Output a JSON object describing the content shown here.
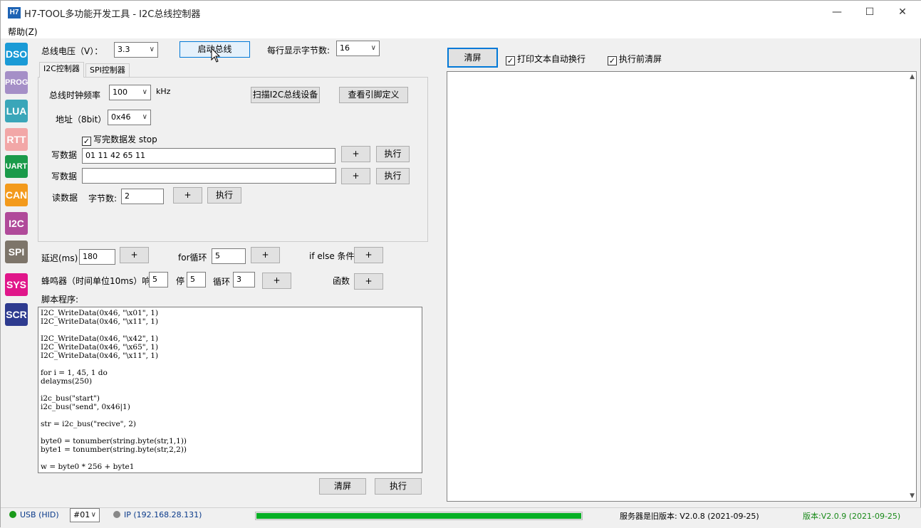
{
  "window": {
    "icon_text": "H7",
    "title": "H7-TOOL多功能开发工具 - I2C总线控制器",
    "min_glyph": "—",
    "max_glyph": "☐",
    "close_glyph": "✕"
  },
  "menu": {
    "help": "帮助(Z)"
  },
  "sidebar": {
    "items": [
      {
        "label": "DSO",
        "color": "#1a9ad6"
      },
      {
        "label": "PROG",
        "color": "#a58fc7"
      },
      {
        "label": "LUA",
        "color": "#3aa6b9"
      },
      {
        "label": "RTT",
        "color": "#f2a7a7"
      },
      {
        "label": "UART",
        "color": "#1a9a4a"
      },
      {
        "label": "CAN",
        "color": "#f39a1c"
      },
      {
        "label": "I2C",
        "color": "#b04a9a"
      },
      {
        "label": "SPI",
        "color": "#7d756a"
      },
      {
        "label": "SYS",
        "color": "#e0168a"
      },
      {
        "label": "SCR",
        "color": "#2e3b8f"
      }
    ]
  },
  "top": {
    "voltage_label": "总线电压（V）：",
    "voltage_value": "3.3",
    "start_bus": "启动总线",
    "bytes_per_line_label": "每行显示字节数:",
    "bytes_per_line_value": "16"
  },
  "tabs": [
    "I2C控制器",
    "SPI控制器"
  ],
  "i2c": {
    "clock_label": "总线时钟频率",
    "clock_value": "100",
    "clock_unit": "kHz",
    "scan_button": "扫描I2C总线设备",
    "pin_button": "查看引脚定义",
    "addr_label": "地址（8bit）",
    "addr_value": "0x46",
    "stop_check": "写完数据发 stop",
    "write_label": "写数据",
    "write1_value": "01 11 42 65 11",
    "write2_value": "",
    "read_label": "读数据",
    "byte_count_label": "字节数:",
    "byte_count_value": "2",
    "plus": "+",
    "exec": "执行"
  },
  "tools": {
    "delay_label": "延迟(ms)",
    "delay_value": "180",
    "for_label": "for循环",
    "for_value": "5",
    "ifelse_label": "if else 条件",
    "beep_label": "蜂鸣器（时间单位10ms）响",
    "beep_on": "5",
    "stop_label": "停",
    "beep_off": "5",
    "loop_label": "循环",
    "loop_value": "3",
    "func_label": "函数"
  },
  "script": {
    "label": "脚本程序:",
    "text": "I2C_WriteData(0x46, \"\\x01\", 1)\nI2C_WriteData(0x46, \"\\x11\", 1)\n\nI2C_WriteData(0x46, \"\\x42\", 1)\nI2C_WriteData(0x46, \"\\x65\", 1)\nI2C_WriteData(0x46, \"\\x11\", 1)\n\nfor i = 1, 45, 1 do\ndelayms(250)\n\ni2c_bus(\"start\")\ni2c_bus(\"send\", 0x46|1)\n\nstr = i2c_bus(\"recive\", 2)\n\nbyte0 = tonumber(string.byte(str,1,1))\nbyte1 = tonumber(string.byte(str,2,2))\n\nw = byte0 * 256 + byte1",
    "clear_button": "清屏",
    "exec_button": "执行"
  },
  "output": {
    "clear_button": "清屏",
    "wrap_check": "打印文本自动换行",
    "clear_before_check": "执行前清屏"
  },
  "status": {
    "usb": "USB (HID)",
    "usb_color": "#1a9a1a",
    "device": "#01",
    "ip": "IP (192.168.28.131)",
    "ip_color": "#888888",
    "progress": 1.0,
    "server_version": "服务器是旧版本: V2.0.8 (2021-09-25)",
    "local_version": "版本:V2.0.9 (2021-09-25)"
  }
}
